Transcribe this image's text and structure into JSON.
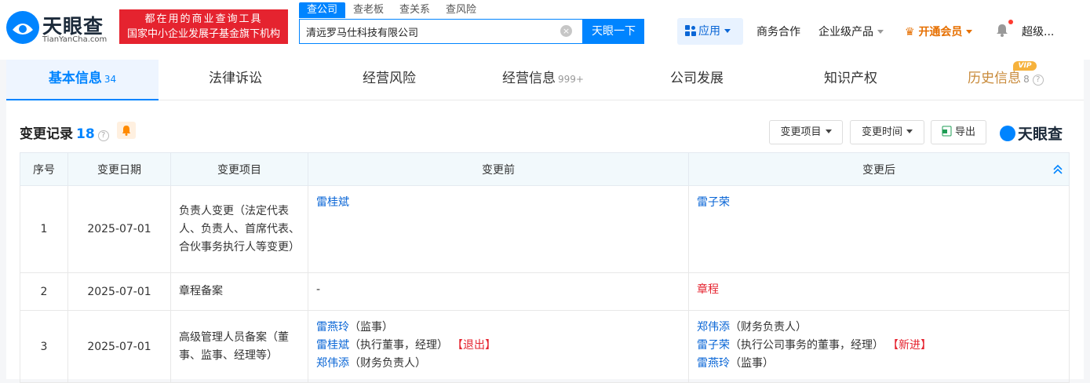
{
  "header": {
    "logo_name": "天眼查",
    "logo_domain": "TianYanCha.com",
    "slogan_line1": "都在用的商业查询工具",
    "slogan_line2": "国家中小企业发展子基金旗下机构",
    "search_tabs": [
      "查公司",
      "查老板",
      "查关系",
      "查风险"
    ],
    "search_value": "清远罗马仕科技有限公司",
    "search_button": "天眼一下",
    "app_button": "应用",
    "nav": {
      "business": "商务合作",
      "enterprise": "企业级产品",
      "vip": "开通会员",
      "user": "超级..."
    }
  },
  "tabs": [
    {
      "label": "基本信息",
      "count": "34"
    },
    {
      "label": "法律诉讼",
      "count": ""
    },
    {
      "label": "经营风险",
      "count": ""
    },
    {
      "label": "经营信息",
      "count": "999+"
    },
    {
      "label": "公司发展",
      "count": ""
    },
    {
      "label": "知识产权",
      "count": ""
    },
    {
      "label": "历史信息",
      "count": "8",
      "badge": "VIP"
    }
  ],
  "section": {
    "title": "变更记录",
    "count": "18",
    "filter_item": "变更项目",
    "filter_time": "变更时间",
    "export": "导出",
    "brand": "天眼查"
  },
  "table": {
    "headers": [
      "序号",
      "变更日期",
      "变更项目",
      "变更前",
      "变更后"
    ],
    "rows": [
      {
        "no": "1",
        "date": "2025-07-01",
        "item": "负责人变更（法定代表人、负责人、首席代表、合伙事务执行人等变更）",
        "before": [
          {
            "name": "雷桂斌",
            "role": "",
            "tag": ""
          }
        ],
        "after": [
          {
            "name": "雷子荣",
            "role": "",
            "tag": ""
          }
        ]
      },
      {
        "no": "2",
        "date": "2025-07-01",
        "item": "章程备案",
        "before_text": "-",
        "after_text": "章程"
      },
      {
        "no": "3",
        "date": "2025-07-01",
        "item": "高级管理人员备案（董事、监事、经理等）",
        "before": [
          {
            "name": "雷燕玲",
            "role": "（监事）",
            "tag": ""
          },
          {
            "name": "雷桂斌",
            "role": "（执行董事，经理）",
            "tag": "【退出】"
          },
          {
            "name": "郑伟添",
            "role": "（财务负责人）",
            "tag": ""
          }
        ],
        "after": [
          {
            "name": "郑伟添",
            "role": "（财务负责人）",
            "tag": ""
          },
          {
            "name": "雷子荣",
            "role": "（执行公司事务的董事，经理）",
            "tag": "【新进】"
          },
          {
            "name": "雷燕玲",
            "role": "（监事）",
            "tag": ""
          }
        ]
      }
    ]
  },
  "colors": {
    "brand_blue": "#0084ff",
    "alert_red": "#e5232f",
    "vip_orange": "#e66f00"
  }
}
